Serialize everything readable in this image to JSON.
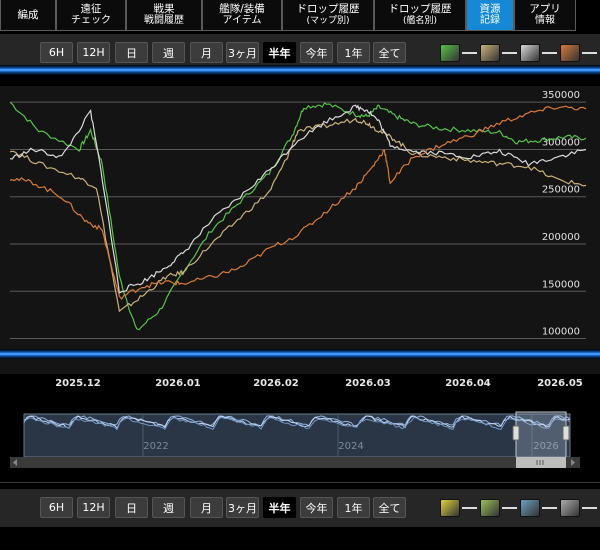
{
  "nav": {
    "tabs": [
      {
        "l1": "編成",
        "l2": ""
      },
      {
        "l1": "遠征",
        "l2": "チェック"
      },
      {
        "l1": "戦果",
        "l2": "戦闘履歴"
      },
      {
        "l1": "艦隊/装備",
        "l2": "アイテム"
      },
      {
        "l1": "ドロップ履歴",
        "l2": "(マップ別)"
      },
      {
        "l1": "ドロップ履歴",
        "l2": "(艦名別)"
      },
      {
        "l1": "資源",
        "l2": "記録"
      },
      {
        "l1": "アプリ",
        "l2": "情報"
      }
    ],
    "active_index": 6
  },
  "range_buttons": [
    "6H",
    "12H",
    "日",
    "週",
    "月",
    "3ヶ月",
    "半年",
    "今年",
    "1年",
    "全て"
  ],
  "top_selected": "半年",
  "bottom_selected": "半年",
  "top_legend": [
    {
      "icon": "fuel-icon",
      "color": "#58c24b"
    },
    {
      "icon": "ammo-icon",
      "color": "#c9b27a"
    },
    {
      "icon": "steel-icon",
      "color": "#d9d9d9"
    },
    {
      "icon": "bauxite-icon",
      "color": "#d97a3a"
    }
  ],
  "bottom_legend": [
    {
      "icon": "repair-bucket-icon",
      "color": "#e0d23c"
    },
    {
      "icon": "dev-material-icon",
      "color": "#9bbf5a"
    },
    {
      "icon": "screw-icon",
      "color": "#6aa0c0"
    },
    {
      "icon": "hammer-icon",
      "color": "#aaaaaa"
    }
  ],
  "chart_data": {
    "type": "line",
    "x_ticks": [
      "2025.12",
      "2026.01",
      "2026.02",
      "2026.03",
      "2026.04",
      "2026.05"
    ],
    "y_ticks": [
      100000,
      150000,
      200000,
      250000,
      300000,
      350000
    ],
    "ylim": [
      90000,
      365000
    ],
    "series": [
      {
        "color": "#58c24b",
        "x": [
          0,
          0.05,
          0.12,
          0.14,
          0.16,
          0.19,
          0.22,
          0.26,
          0.3,
          0.35,
          0.4,
          0.45,
          0.49,
          0.51,
          0.55,
          0.6,
          0.62,
          0.64,
          0.67,
          0.7,
          0.75,
          0.8,
          0.85,
          0.88,
          0.92,
          0.96,
          1
        ],
        "values": [
          350000,
          320000,
          300000,
          320000,
          285000,
          165000,
          108000,
          130000,
          170000,
          215000,
          245000,
          275000,
          315000,
          345000,
          348000,
          337000,
          335000,
          345000,
          335000,
          327000,
          322000,
          320000,
          318000,
          308000,
          310000,
          313000,
          312000
        ]
      },
      {
        "color": "#c9b27a",
        "x": [
          0,
          0.05,
          0.12,
          0.15,
          0.19,
          0.23,
          0.27,
          0.3,
          0.35,
          0.4,
          0.45,
          0.48,
          0.5,
          0.55,
          0.6,
          0.62,
          0.64,
          0.67,
          0.7,
          0.75,
          0.8,
          0.85,
          0.9,
          0.95,
          1
        ],
        "values": [
          300000,
          285000,
          270000,
          260000,
          128000,
          145000,
          165000,
          170000,
          200000,
          228000,
          255000,
          290000,
          320000,
          325000,
          332000,
          328000,
          320000,
          310000,
          295000,
          292000,
          288000,
          285000,
          282000,
          268000,
          262000
        ]
      },
      {
        "color": "#d9d9d9",
        "x": [
          0,
          0.04,
          0.09,
          0.14,
          0.16,
          0.19,
          0.23,
          0.27,
          0.3,
          0.35,
          0.4,
          0.45,
          0.5,
          0.55,
          0.6,
          0.62,
          0.64,
          0.66,
          0.7,
          0.75,
          0.8,
          0.85,
          0.9,
          0.95,
          1
        ],
        "values": [
          290000,
          300000,
          292000,
          340000,
          270000,
          150000,
          160000,
          175000,
          190000,
          225000,
          250000,
          278000,
          310000,
          330000,
          345000,
          342000,
          330000,
          305000,
          298000,
          296000,
          292000,
          298000,
          285000,
          292000,
          300000
        ]
      },
      {
        "color": "#d97a3a",
        "x": [
          0,
          0.04,
          0.09,
          0.13,
          0.16,
          0.19,
          0.23,
          0.27,
          0.3,
          0.35,
          0.4,
          0.45,
          0.5,
          0.55,
          0.6,
          0.63,
          0.65,
          0.66,
          0.7,
          0.75,
          0.8,
          0.85,
          0.9,
          0.95,
          1
        ],
        "values": [
          270000,
          265000,
          250000,
          225000,
          215000,
          143000,
          155000,
          160000,
          158000,
          165000,
          175000,
          195000,
          210000,
          235000,
          260000,
          282000,
          300000,
          265000,
          292000,
          305000,
          315000,
          328000,
          338000,
          345000,
          343000
        ]
      }
    ]
  },
  "navigator": {
    "labels": [
      "2022",
      "2024",
      "2026"
    ]
  }
}
